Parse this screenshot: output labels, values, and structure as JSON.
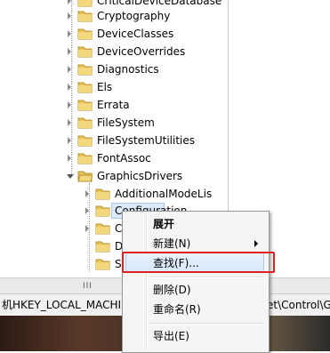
{
  "tree": {
    "nodes": [
      {
        "label": "CriticalDeviceDatabase",
        "icon": "folder-icon",
        "expander": "collapsed"
      },
      {
        "label": "Cryptography",
        "icon": "folder-icon",
        "expander": "collapsed"
      },
      {
        "label": "DeviceClasses",
        "icon": "folder-icon",
        "expander": "collapsed"
      },
      {
        "label": "DeviceOverrides",
        "icon": "folder-icon",
        "expander": "collapsed"
      },
      {
        "label": "Diagnostics",
        "icon": "folder-icon",
        "expander": "collapsed"
      },
      {
        "label": "Els",
        "icon": "folder-icon",
        "expander": "collapsed"
      },
      {
        "label": "Errata",
        "icon": "folder-icon",
        "expander": "collapsed"
      },
      {
        "label": "FileSystem",
        "icon": "folder-icon",
        "expander": "collapsed"
      },
      {
        "label": "FileSystemUtilities",
        "icon": "folder-icon",
        "expander": "collapsed"
      },
      {
        "label": "FontAssoc",
        "icon": "folder-icon",
        "expander": "collapsed"
      },
      {
        "label": "GraphicsDrivers",
        "icon": "folder-icon",
        "expander": "expanded"
      },
      {
        "label": "AdditionalModeLis",
        "icon": "folder-icon",
        "expander": "collapsed"
      },
      {
        "label": "Configuration",
        "icon": "folder-icon",
        "expander": "collapsed",
        "selected": true
      },
      {
        "label": "C",
        "icon": "folder-icon",
        "expander": "collapsed"
      },
      {
        "label": "D",
        "icon": "folder-icon",
        "expander": "none"
      },
      {
        "label": "S",
        "icon": "folder-icon",
        "expander": "none"
      }
    ]
  },
  "scrollbar": {
    "grip": "III"
  },
  "statusbar": {
    "left": "机HKEY_LOCAL_MACHINI",
    "right": "et\\Control\\G"
  },
  "context_menu": {
    "items": [
      {
        "label": "展开",
        "bold": true
      },
      {
        "label": "新建(N)",
        "submenu": true
      },
      {
        "label": "查找(F)...",
        "highlighted": true
      },
      {
        "label": "删除(D)"
      },
      {
        "label": "重命名(R)"
      },
      {
        "label": "导出(E)"
      }
    ]
  },
  "colors": {
    "highlight_box": "#e02020",
    "folder": "#e8c25a",
    "selection": "#dbe9fb"
  }
}
